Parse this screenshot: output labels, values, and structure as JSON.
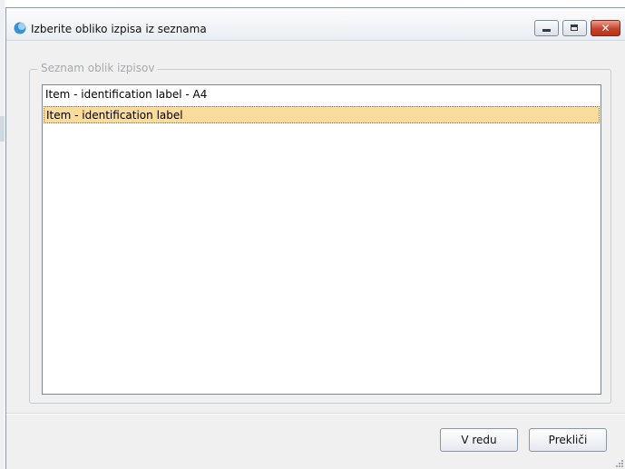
{
  "window": {
    "title": "Izberite obliko izpisa iz seznama",
    "icon": "app-icon",
    "controls": {
      "minimize_icon": "minimize-icon",
      "maximize_icon": "maximize-icon",
      "close_icon": "close-icon",
      "close_glyph": "✕"
    }
  },
  "group": {
    "legend": "Seznam oblik izpisov",
    "items": [
      {
        "label": "Item - identification label - A4",
        "selected": false
      },
      {
        "label": "Item - identification label",
        "selected": true
      }
    ]
  },
  "buttons": {
    "ok_label": "V redu",
    "cancel_label": "Prekliči"
  },
  "colors": {
    "selection": "#fbdc9c",
    "close_button": "#c5432b",
    "dialog_background": "#f0f0f0"
  }
}
